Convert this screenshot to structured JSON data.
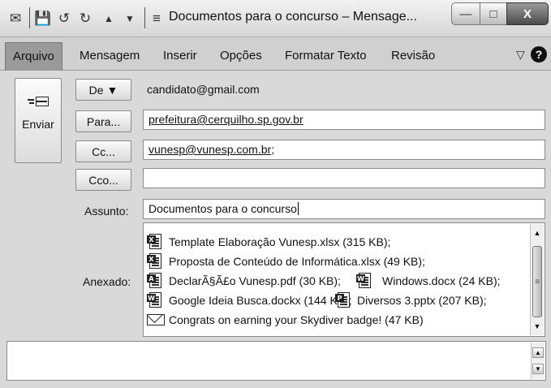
{
  "window": {
    "title": "Documentos para o concurso – Mensage...",
    "minimize_glyph": "—",
    "maximize_glyph": "□",
    "close_glyph": "X"
  },
  "quick_access": {
    "save_glyph": "💾",
    "undo_glyph": "↺",
    "redo_glyph": "↻",
    "up_glyph": "▲",
    "down_glyph": "▼",
    "customize_glyph": "≡"
  },
  "ribbon": {
    "tabs": [
      "Arquivo",
      "Mensagem",
      "Inserir",
      "Opções",
      "Formatar Texto",
      "Revisão"
    ],
    "active_tab": "Arquivo",
    "collapse_glyph": "▽",
    "help_glyph": "?"
  },
  "compose": {
    "send_label": "Enviar",
    "from_button": "De ▼",
    "from_value": "candidato@gmail.com",
    "to_button": "Para...",
    "to_value": "prefeitura@cerquilho.sp.gov.br",
    "cc_button": "Cc...",
    "cc_value": "vunesp@vunesp.com.br",
    "cc_suffix": ";",
    "bcc_button": "Cco...",
    "bcc_value": "",
    "subject_label": "Assunto:",
    "subject_value": "Documentos para o concurso",
    "attached_label": "Anexado:"
  },
  "attachments": {
    "a1": {
      "badge": "X",
      "name": "Template Elaboração Vunesp.xlsx (315 KB);"
    },
    "a2": {
      "badge": "X",
      "name": "Proposta de Conteúdo de Informática.xlsx (49 KB);"
    },
    "a3": {
      "badge": "A",
      "name": "DeclarÃ§Ã£o Vunesp.pdf (30 KB);"
    },
    "a4": {
      "badge": "W",
      "name": "Windows.docx (24 KB);"
    },
    "a5": {
      "badge": "W",
      "name": "Google Ideia Busca.dockx (144 KB);"
    },
    "a6": {
      "badge": "P",
      "name": "Diversos 3.pptx (207 KB);"
    },
    "a7": {
      "name": "Congrats on earning your Skydiver badge! (47 KB)"
    }
  },
  "body": {
    "text": ""
  },
  "colors": {
    "window_bg": "#d9d9d9",
    "active_tab_bg": "#9a9a9a",
    "field_bg": "#ffffff"
  }
}
